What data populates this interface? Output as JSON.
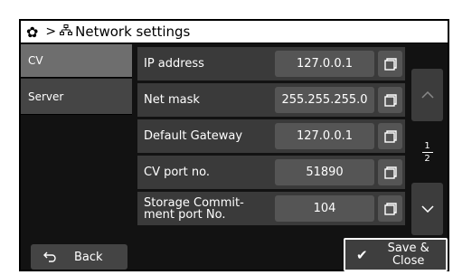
{
  "window": {
    "title": "Network settings",
    "separator": ">"
  },
  "sidebar": {
    "items": [
      {
        "label": "CV",
        "selected": true
      },
      {
        "label": "Server",
        "selected": false
      }
    ]
  },
  "settings": [
    {
      "label": "IP address",
      "value": "127.0.0.1"
    },
    {
      "label": "Net mask",
      "value": "255.255.255.0"
    },
    {
      "label": "Default Gateway",
      "value": "127.0.0.1"
    },
    {
      "label": "CV port no.",
      "value": "51890"
    },
    {
      "label": "Storage Commit-\nment port No.",
      "value": "104"
    }
  ],
  "pager": {
    "current": "1",
    "total": "2"
  },
  "footer": {
    "back_label": "Back",
    "save_label": "Save &\nClose"
  },
  "colors": {
    "panel": "#121212",
    "row": "#3a3a3a",
    "selected_tab": "#6e6e6e"
  }
}
